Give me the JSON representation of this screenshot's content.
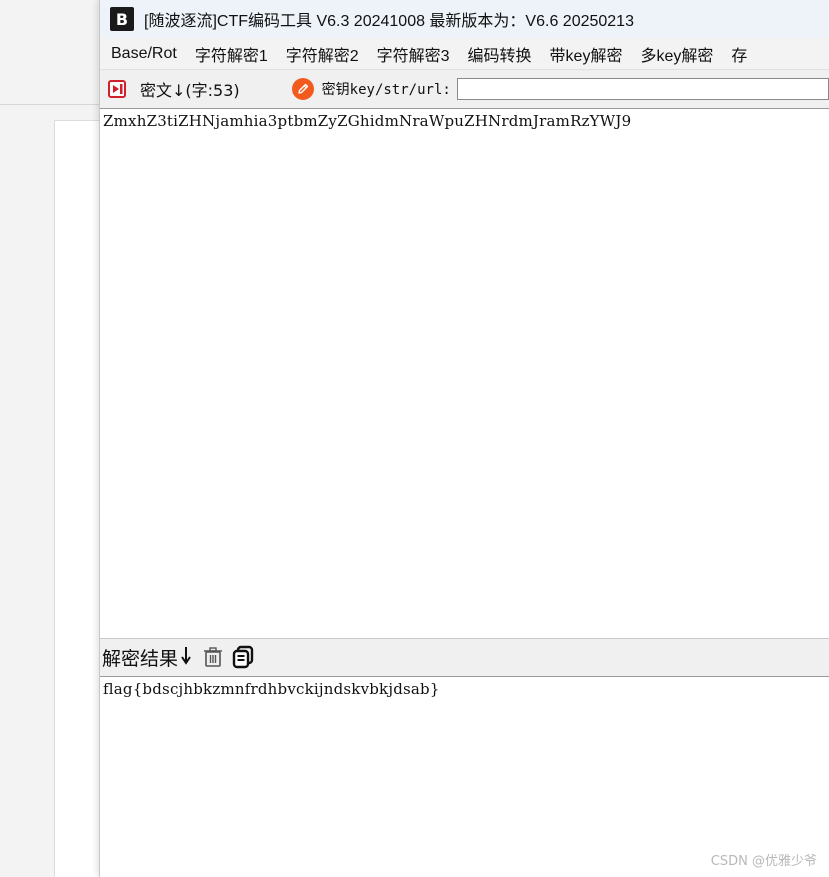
{
  "window": {
    "logo": "B",
    "title": "[随波逐流]CTF编码工具 V6.3 20241008     最新版本为：V6.6 20250213"
  },
  "menu": {
    "items": [
      "Base/Rot",
      "字符解密1",
      "字符解密2",
      "字符解密3",
      "编码转换",
      "带key解密",
      "多key解密",
      "存"
    ]
  },
  "toolbar": {
    "cipher_label": "密文↓(字:53)",
    "key_label": "密钥key/str/url:",
    "key_value": ""
  },
  "cipher": {
    "text": "ZmxhZ3tiZHNjamhia3ptbmZyZGhidmNraWpuZHNrdmJramRzYWJ9"
  },
  "result": {
    "label": "解密结果",
    "text": "flag{bdscjhbkzmnfrdhbvckijndskvbkjdsab}"
  },
  "icons": {
    "cipher": "cipher-import-icon",
    "key": "edit-key-icon",
    "arrow": "arrow-down-icon",
    "trash": "trash-icon",
    "copy": "copy-icon"
  },
  "watermark": "CSDN @优雅少爷",
  "colors": {
    "accent_orange": "#f25a1e",
    "accent_red": "#d0202a"
  }
}
